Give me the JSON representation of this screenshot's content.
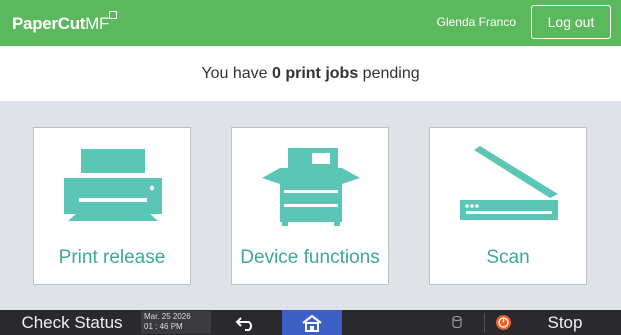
{
  "header": {
    "logo_text": "PaperCut",
    "logo_suffix": "MF",
    "user_name": "Glenda Franco",
    "logout_label": "Log out"
  },
  "pending": {
    "prefix": "You have ",
    "count_text": "0 print jobs",
    "suffix": " pending"
  },
  "tiles": [
    {
      "label": "Print release",
      "icon": "printer-icon"
    },
    {
      "label": "Device functions",
      "icon": "copier-icon"
    },
    {
      "label": "Scan",
      "icon": "scanner-icon"
    }
  ],
  "statusbar": {
    "check_status_label": "Check Status",
    "date": "Mar. 25 2026",
    "time": "01 : 46 PM",
    "stop_label": "Stop"
  },
  "colors": {
    "header_green": "#5cb85c",
    "tile_teal": "#3ea89a",
    "icon_teal": "#5cc6b6",
    "home_blue": "#3b5fc4",
    "stop_orange": "#e8622a"
  }
}
